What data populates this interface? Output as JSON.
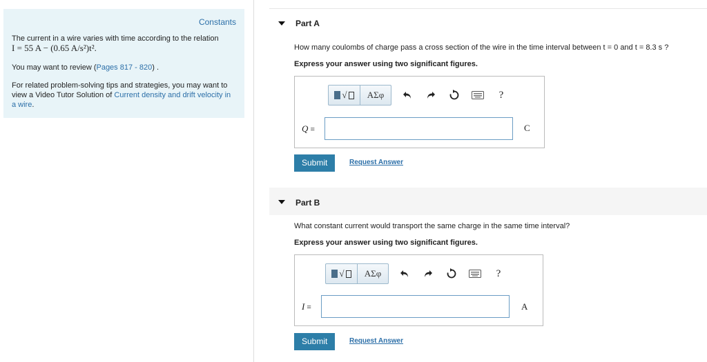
{
  "left_panel": {
    "constants_label": "Constants",
    "p1_prefix": "The current in a wire varies with time according to the relation",
    "p1_formula": "I = 55 A − (0.65 A/s²)t².",
    "p2_prefix": "You may want to review (",
    "p2_link": "Pages 817 - 820",
    "p2_suffix": ") .",
    "p3_prefix": "For related problem-solving tips and strategies, you may want to view a Video Tutor Solution of ",
    "p3_link": "Current density and drift velocity in a wire",
    "p3_suffix": "."
  },
  "part_a": {
    "title": "Part A",
    "question": "How many coulombs of charge pass a cross section of the wire in the time interval between t = 0 and t = 8.3 s ?",
    "instruction": "Express your answer using two significant figures.",
    "toolbar": {
      "greek_label": "ΑΣφ",
      "help_label": "?"
    },
    "var_name": "Q",
    "equals": " =",
    "input_value": "",
    "unit": "C",
    "submit_label": "Submit",
    "request_label": "Request Answer"
  },
  "part_b": {
    "title": "Part B",
    "question": "What constant current would transport the same charge in the same time interval?",
    "instruction": "Express your answer using two significant figures.",
    "toolbar": {
      "greek_label": "ΑΣφ",
      "help_label": "?"
    },
    "var_name": "I",
    "equals": " =",
    "input_value": "",
    "unit": "A",
    "submit_label": "Submit",
    "request_label": "Request Answer"
  }
}
